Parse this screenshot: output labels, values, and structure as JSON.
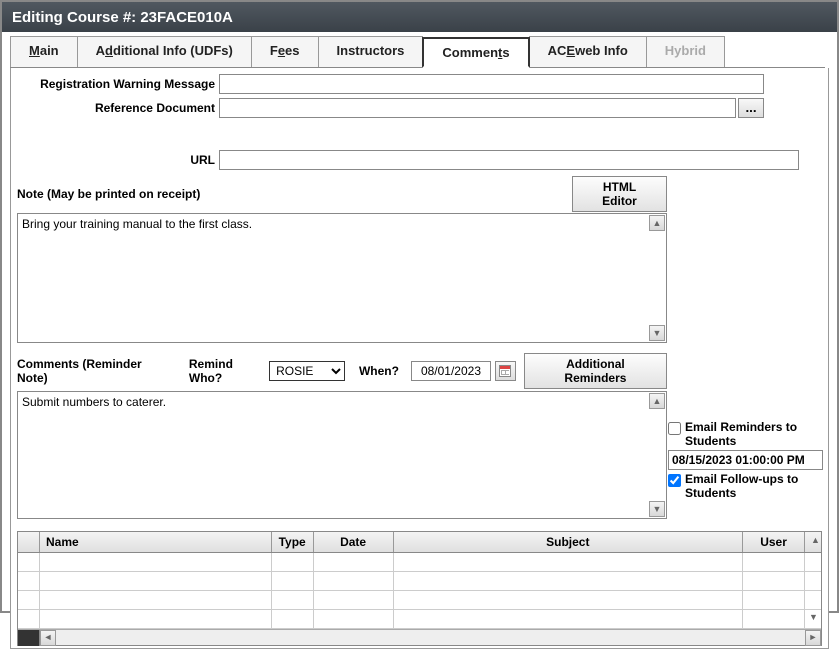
{
  "window": {
    "title": "Editing Course #: 23FACE010A"
  },
  "tabs": {
    "main": "Main",
    "additional": "Additional Info (UDFs)",
    "fees": "Fees",
    "instructors": "Instructors",
    "comments": "Comments",
    "aceweb": "ACEweb Info",
    "hybrid": "Hybrid"
  },
  "labels": {
    "reg_warning": "Registration Warning Message",
    "ref_doc": "Reference Document",
    "url": "URL",
    "note_section": "Note (May be printed on receipt)",
    "html_editor_btn": "HTML Editor",
    "comments_section": "Comments (Reminder Note)",
    "remind_who": "Remind Who?",
    "when": "When?",
    "additional_reminders_btn": "Additional Reminders",
    "email_reminders": "Email Reminders to Students",
    "email_followups": "Email Follow-ups to Students",
    "ref_doc_browse": "..."
  },
  "fields": {
    "reg_warning": "",
    "ref_doc": "",
    "url": "",
    "note_text": "Bring your training manual to the first class.",
    "remind_who": "ROSIE",
    "when_date": "08/01/2023",
    "comments_text": "Submit numbers to caterer.",
    "email_reminders_checked": false,
    "reminder_datetime": "08/15/2023 01:00:00 PM",
    "email_followups_checked": true,
    "remind_who_options": [
      "ROSIE"
    ]
  },
  "grid": {
    "headers": {
      "name": "Name",
      "type": "Type",
      "date": "Date",
      "subject": "Subject",
      "user": "User"
    },
    "rows": [
      {
        "name": "",
        "type": "",
        "date": "",
        "subject": "",
        "user": ""
      },
      {
        "name": "",
        "type": "",
        "date": "",
        "subject": "",
        "user": ""
      },
      {
        "name": "",
        "type": "",
        "date": "",
        "subject": "",
        "user": ""
      },
      {
        "name": "",
        "type": "",
        "date": "",
        "subject": "",
        "user": ""
      }
    ]
  }
}
